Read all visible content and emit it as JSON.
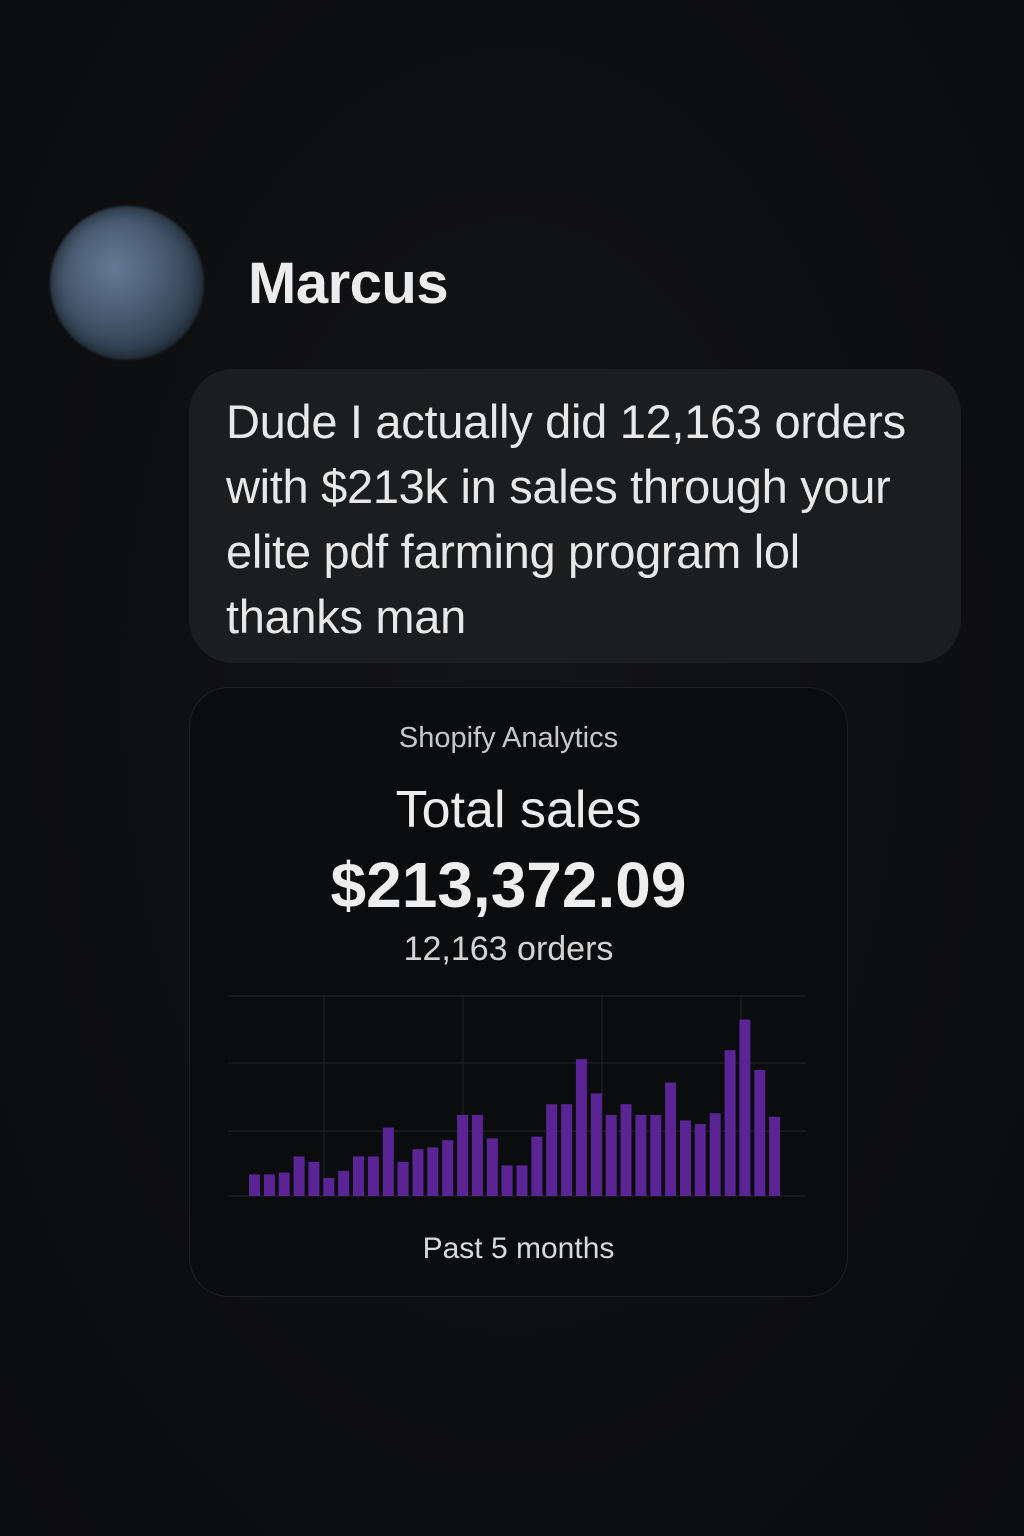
{
  "contact": {
    "name": "Marcus"
  },
  "message": {
    "text": "Dude I actually did 12,163 orders with $213k in sales through your elite pdf farming program lol thanks man"
  },
  "card": {
    "source": "Shopify Analytics",
    "metric_label": "Total sales",
    "metric_value": "$213,372.09",
    "orders": "12,163 orders",
    "period": "Past 5 months"
  },
  "colors": {
    "bar": "#5a2494",
    "grid": "#222427"
  },
  "chart_data": {
    "type": "bar",
    "ylim": [
      0,
      100
    ],
    "grid": true,
    "values": [
      12,
      12,
      13,
      22,
      19,
      10,
      14,
      22,
      22,
      38,
      19,
      26,
      27,
      31,
      45,
      45,
      32,
      17,
      17,
      33,
      51,
      51,
      76,
      57,
      45,
      51,
      45,
      45,
      63,
      42,
      40,
      46,
      81,
      98,
      70,
      44
    ]
  }
}
